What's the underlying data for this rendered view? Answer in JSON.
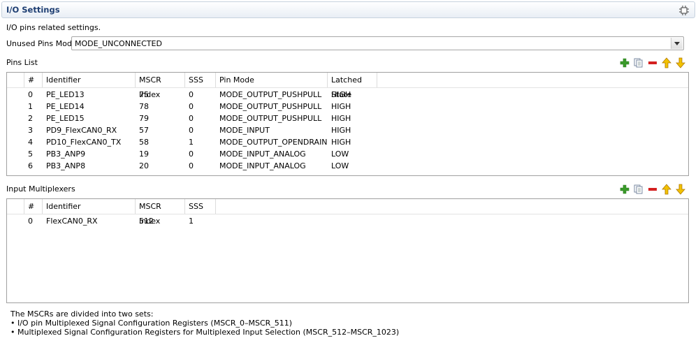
{
  "header": {
    "title": "I/O Settings",
    "icon": "chip-icon"
  },
  "description": "I/O pins related settings.",
  "unused_pins": {
    "label": "Unused Pins Mode",
    "value": "MODE_UNCONNECTED"
  },
  "pins_list": {
    "title": "Pins List",
    "columns": [
      "#",
      "Identifier",
      "MSCR Index",
      "SSS",
      "Pin Mode",
      "Latched State"
    ],
    "rows": [
      [
        "0",
        "PE_LED13",
        "75",
        "0",
        "MODE_OUTPUT_PUSHPULL",
        "HIGH"
      ],
      [
        "1",
        "PE_LED14",
        "78",
        "0",
        "MODE_OUTPUT_PUSHPULL",
        "HIGH"
      ],
      [
        "2",
        "PE_LED15",
        "79",
        "0",
        "MODE_OUTPUT_PUSHPULL",
        "HIGH"
      ],
      [
        "3",
        "PD9_FlexCAN0_RX",
        "57",
        "0",
        "MODE_INPUT",
        "HIGH"
      ],
      [
        "4",
        "PD10_FlexCAN0_TX",
        "58",
        "1",
        "MODE_OUTPUT_OPENDRAIN",
        "HIGH"
      ],
      [
        "5",
        "PB3_ANP9",
        "19",
        "0",
        "MODE_INPUT_ANALOG",
        "LOW"
      ],
      [
        "6",
        "PB3_ANP8",
        "20",
        "0",
        "MODE_INPUT_ANALOG",
        "LOW"
      ]
    ]
  },
  "input_multiplexers": {
    "title": "Input Multiplexers",
    "columns": [
      "#",
      "Identifier",
      "MSCR Index",
      "SSS"
    ],
    "rows": [
      [
        "0",
        "FlexCAN0_RX",
        "512",
        "1"
      ]
    ]
  },
  "toolbar_icons": [
    "add-icon",
    "copy-icon",
    "remove-icon",
    "move-up-icon",
    "move-down-icon"
  ],
  "colors": {
    "title": "#1f3f73",
    "add": "#3a9a2a",
    "remove": "#d42020",
    "arrow": "#e0a000"
  },
  "footnote": [
    "The MSCRs are divided into two sets:",
    "• I/O pin Multiplexed Signal Configuration Registers (MSCR_0–MSCR_511)",
    "• Multiplexed Signal Configuration Registers for Multiplexed Input Selection (MSCR_512–MSCR_1023)"
  ]
}
